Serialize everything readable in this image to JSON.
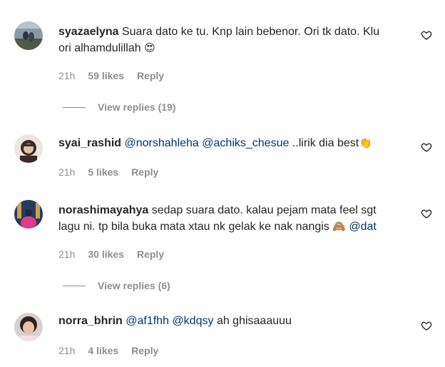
{
  "comments": [
    {
      "username": "syazaelyna",
      "text_line1": "Suara dato ke tu. Knp lain bebenor. Ori tk dato. Klu",
      "text_line2": "ori alhamdulillah",
      "emoji": "😍",
      "time": "21h",
      "likes": "59 likes",
      "reply": "Reply",
      "view_replies": "View replies (19)"
    },
    {
      "username": "syai_rashid",
      "mention1": "@norshahleha",
      "mention2": "@achiks_chesue",
      "text": "..lirik dia best",
      "emoji": "👏",
      "time": "21h",
      "likes": "5 likes",
      "reply": "Reply"
    },
    {
      "username": "norashimayahya",
      "text_line1": "sedap suara dato. kalau pejam mata feel sgt",
      "text_line2": "lagu ni. tp bila buka mata xtau nk gelak ke nak nangis",
      "emoji": "🙈",
      "mention": "@dat",
      "time": "21h",
      "likes": "30 likes",
      "reply": "Reply",
      "view_replies": "View replies (6)"
    },
    {
      "username": "norra_bhrin",
      "mention1": "@af1fhh",
      "mention2": "@kdqsy",
      "text": "ah ghisaaauuu",
      "time": "21h",
      "likes": "4 likes",
      "reply": "Reply"
    }
  ],
  "icons": {
    "like": "heart-outline-icon"
  },
  "colors": {
    "text": "#262626",
    "muted": "#8e8e8e",
    "mention": "#00376b"
  }
}
